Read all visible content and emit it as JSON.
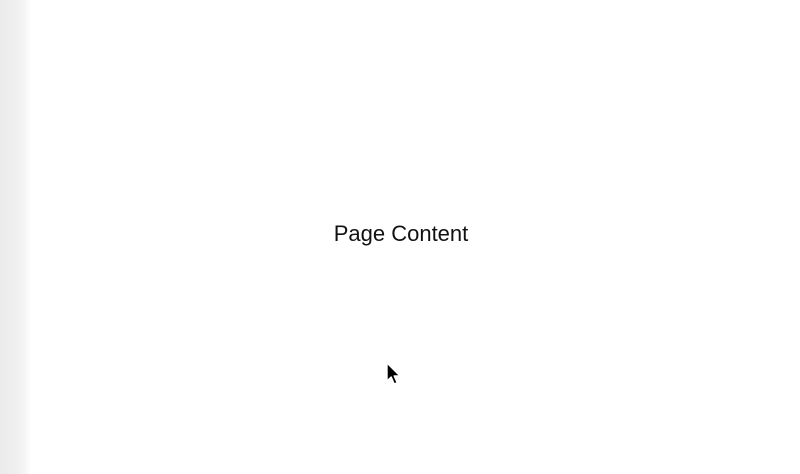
{
  "main": {
    "content_label": "Page Content"
  },
  "drawer": {
    "state": "closed"
  },
  "cursor": {
    "icon": "mouse-pointer-icon"
  }
}
